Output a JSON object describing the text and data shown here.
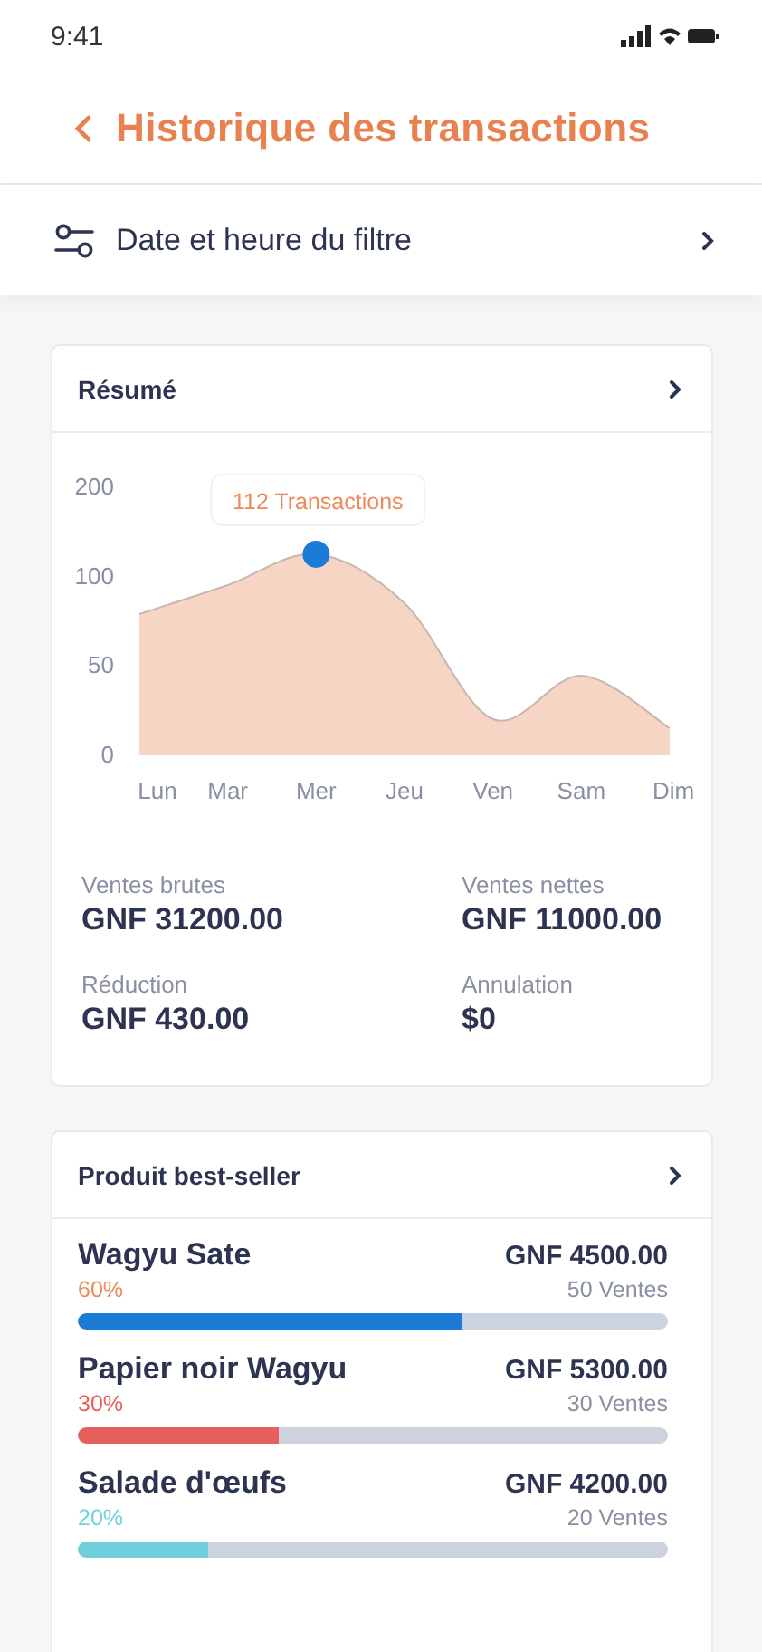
{
  "status_bar": {
    "time": "9:41"
  },
  "header": {
    "title": "Historique des transactions"
  },
  "filter": {
    "label": "Date et heure du filtre"
  },
  "summary": {
    "title": "Résumé",
    "chart": {
      "y_labels": [
        "200",
        "100",
        "50",
        "0"
      ],
      "x_labels": [
        "Lun",
        "Mar",
        "Mer",
        "Jeu",
        "Ven",
        "Sam",
        "Dim"
      ],
      "tooltip": "112 Transactions"
    },
    "stats": [
      {
        "label": "Ventes brutes",
        "value": "GNF 31200.00"
      },
      {
        "label": "Ventes nettes",
        "value": "GNF 11000.00"
      },
      {
        "label": "Réduction",
        "value": "GNF 430.00"
      },
      {
        "label": "Annulation",
        "value": "$0"
      }
    ]
  },
  "best_sellers": {
    "title": "Produit best-seller",
    "items": [
      {
        "name": "Wagyu Sate",
        "percent": {
          "text": "60%",
          "color": "#eb8a5a"
        },
        "price": "GNF 4500.00",
        "sales": "50 Ventes",
        "level": 0.65,
        "color": "#1b7bd6"
      },
      {
        "name": "Papier noir Wagyu",
        "percent": {
          "text": "30%",
          "color": "#e8605e"
        },
        "price": "GNF 5300.00",
        "sales": "30 Ventes",
        "level": 0.34,
        "color": "#e8605e"
      },
      {
        "name": "Salade d'œufs",
        "percent": {
          "text": "20%",
          "color": "#6fd0dc"
        },
        "price": "GNF 4200.00",
        "sales": "20 Ventes",
        "level": 0.22,
        "color": "#6fd0dc"
      }
    ]
  }
}
